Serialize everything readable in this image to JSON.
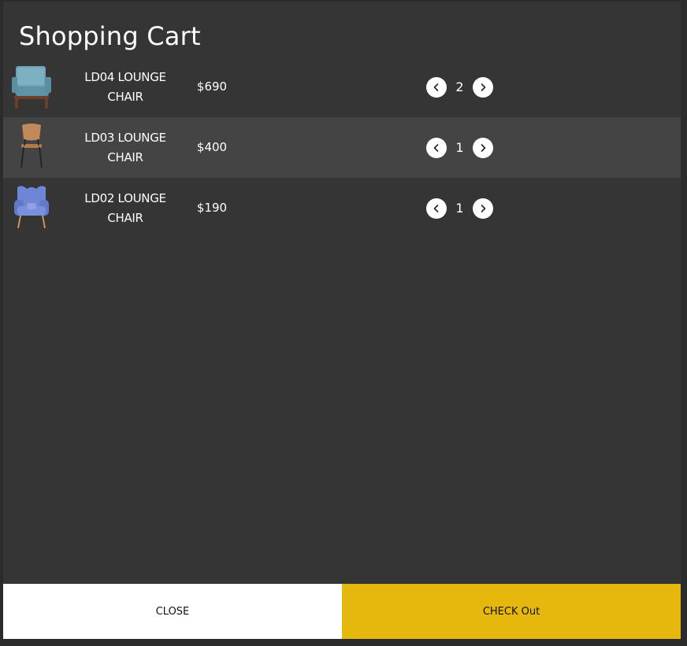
{
  "cart": {
    "title": "Shopping Cart",
    "items": [
      {
        "name": "LD04 LOUNGE CHAIR",
        "price": "$690",
        "quantity": "2",
        "image_icon": "teal-armchair-icon"
      },
      {
        "name": "LD03 LOUNGE CHAIR",
        "price": "$400",
        "quantity": "1",
        "image_icon": "wood-chair-icon"
      },
      {
        "name": "LD02 LOUNGE CHAIR",
        "price": "$190",
        "quantity": "1",
        "image_icon": "blue-wingchair-icon"
      }
    ],
    "decrease_icon": "chevron-left-icon",
    "increase_icon": "chevron-right-icon"
  },
  "footer": {
    "close_label": "CLOSE",
    "checkout_label": "CHECK Out"
  },
  "colors": {
    "background": "#353535",
    "row_highlight": "#444444",
    "accent": "#e6b80e",
    "text": "#ffffff"
  }
}
